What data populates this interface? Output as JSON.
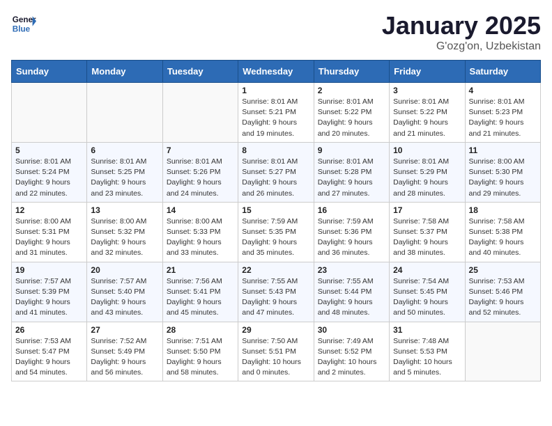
{
  "header": {
    "logo_line1": "General",
    "logo_line2": "Blue",
    "title": "January 2025",
    "subtitle": "G'ozg'on, Uzbekistan"
  },
  "weekdays": [
    "Sunday",
    "Monday",
    "Tuesday",
    "Wednesday",
    "Thursday",
    "Friday",
    "Saturday"
  ],
  "weeks": [
    [
      {
        "day": "",
        "sunrise": "",
        "sunset": "",
        "daylight": ""
      },
      {
        "day": "",
        "sunrise": "",
        "sunset": "",
        "daylight": ""
      },
      {
        "day": "",
        "sunrise": "",
        "sunset": "",
        "daylight": ""
      },
      {
        "day": "1",
        "sunrise": "Sunrise: 8:01 AM",
        "sunset": "Sunset: 5:21 PM",
        "daylight": "Daylight: 9 hours and 19 minutes."
      },
      {
        "day": "2",
        "sunrise": "Sunrise: 8:01 AM",
        "sunset": "Sunset: 5:22 PM",
        "daylight": "Daylight: 9 hours and 20 minutes."
      },
      {
        "day": "3",
        "sunrise": "Sunrise: 8:01 AM",
        "sunset": "Sunset: 5:22 PM",
        "daylight": "Daylight: 9 hours and 21 minutes."
      },
      {
        "day": "4",
        "sunrise": "Sunrise: 8:01 AM",
        "sunset": "Sunset: 5:23 PM",
        "daylight": "Daylight: 9 hours and 21 minutes."
      }
    ],
    [
      {
        "day": "5",
        "sunrise": "Sunrise: 8:01 AM",
        "sunset": "Sunset: 5:24 PM",
        "daylight": "Daylight: 9 hours and 22 minutes."
      },
      {
        "day": "6",
        "sunrise": "Sunrise: 8:01 AM",
        "sunset": "Sunset: 5:25 PM",
        "daylight": "Daylight: 9 hours and 23 minutes."
      },
      {
        "day": "7",
        "sunrise": "Sunrise: 8:01 AM",
        "sunset": "Sunset: 5:26 PM",
        "daylight": "Daylight: 9 hours and 24 minutes."
      },
      {
        "day": "8",
        "sunrise": "Sunrise: 8:01 AM",
        "sunset": "Sunset: 5:27 PM",
        "daylight": "Daylight: 9 hours and 26 minutes."
      },
      {
        "day": "9",
        "sunrise": "Sunrise: 8:01 AM",
        "sunset": "Sunset: 5:28 PM",
        "daylight": "Daylight: 9 hours and 27 minutes."
      },
      {
        "day": "10",
        "sunrise": "Sunrise: 8:01 AM",
        "sunset": "Sunset: 5:29 PM",
        "daylight": "Daylight: 9 hours and 28 minutes."
      },
      {
        "day": "11",
        "sunrise": "Sunrise: 8:00 AM",
        "sunset": "Sunset: 5:30 PM",
        "daylight": "Daylight: 9 hours and 29 minutes."
      }
    ],
    [
      {
        "day": "12",
        "sunrise": "Sunrise: 8:00 AM",
        "sunset": "Sunset: 5:31 PM",
        "daylight": "Daylight: 9 hours and 31 minutes."
      },
      {
        "day": "13",
        "sunrise": "Sunrise: 8:00 AM",
        "sunset": "Sunset: 5:32 PM",
        "daylight": "Daylight: 9 hours and 32 minutes."
      },
      {
        "day": "14",
        "sunrise": "Sunrise: 8:00 AM",
        "sunset": "Sunset: 5:33 PM",
        "daylight": "Daylight: 9 hours and 33 minutes."
      },
      {
        "day": "15",
        "sunrise": "Sunrise: 7:59 AM",
        "sunset": "Sunset: 5:35 PM",
        "daylight": "Daylight: 9 hours and 35 minutes."
      },
      {
        "day": "16",
        "sunrise": "Sunrise: 7:59 AM",
        "sunset": "Sunset: 5:36 PM",
        "daylight": "Daylight: 9 hours and 36 minutes."
      },
      {
        "day": "17",
        "sunrise": "Sunrise: 7:58 AM",
        "sunset": "Sunset: 5:37 PM",
        "daylight": "Daylight: 9 hours and 38 minutes."
      },
      {
        "day": "18",
        "sunrise": "Sunrise: 7:58 AM",
        "sunset": "Sunset: 5:38 PM",
        "daylight": "Daylight: 9 hours and 40 minutes."
      }
    ],
    [
      {
        "day": "19",
        "sunrise": "Sunrise: 7:57 AM",
        "sunset": "Sunset: 5:39 PM",
        "daylight": "Daylight: 9 hours and 41 minutes."
      },
      {
        "day": "20",
        "sunrise": "Sunrise: 7:57 AM",
        "sunset": "Sunset: 5:40 PM",
        "daylight": "Daylight: 9 hours and 43 minutes."
      },
      {
        "day": "21",
        "sunrise": "Sunrise: 7:56 AM",
        "sunset": "Sunset: 5:41 PM",
        "daylight": "Daylight: 9 hours and 45 minutes."
      },
      {
        "day": "22",
        "sunrise": "Sunrise: 7:55 AM",
        "sunset": "Sunset: 5:43 PM",
        "daylight": "Daylight: 9 hours and 47 minutes."
      },
      {
        "day": "23",
        "sunrise": "Sunrise: 7:55 AM",
        "sunset": "Sunset: 5:44 PM",
        "daylight": "Daylight: 9 hours and 48 minutes."
      },
      {
        "day": "24",
        "sunrise": "Sunrise: 7:54 AM",
        "sunset": "Sunset: 5:45 PM",
        "daylight": "Daylight: 9 hours and 50 minutes."
      },
      {
        "day": "25",
        "sunrise": "Sunrise: 7:53 AM",
        "sunset": "Sunset: 5:46 PM",
        "daylight": "Daylight: 9 hours and 52 minutes."
      }
    ],
    [
      {
        "day": "26",
        "sunrise": "Sunrise: 7:53 AM",
        "sunset": "Sunset: 5:47 PM",
        "daylight": "Daylight: 9 hours and 54 minutes."
      },
      {
        "day": "27",
        "sunrise": "Sunrise: 7:52 AM",
        "sunset": "Sunset: 5:49 PM",
        "daylight": "Daylight: 9 hours and 56 minutes."
      },
      {
        "day": "28",
        "sunrise": "Sunrise: 7:51 AM",
        "sunset": "Sunset: 5:50 PM",
        "daylight": "Daylight: 9 hours and 58 minutes."
      },
      {
        "day": "29",
        "sunrise": "Sunrise: 7:50 AM",
        "sunset": "Sunset: 5:51 PM",
        "daylight": "Daylight: 10 hours and 0 minutes."
      },
      {
        "day": "30",
        "sunrise": "Sunrise: 7:49 AM",
        "sunset": "Sunset: 5:52 PM",
        "daylight": "Daylight: 10 hours and 2 minutes."
      },
      {
        "day": "31",
        "sunrise": "Sunrise: 7:48 AM",
        "sunset": "Sunset: 5:53 PM",
        "daylight": "Daylight: 10 hours and 5 minutes."
      },
      {
        "day": "",
        "sunrise": "",
        "sunset": "",
        "daylight": ""
      }
    ]
  ]
}
